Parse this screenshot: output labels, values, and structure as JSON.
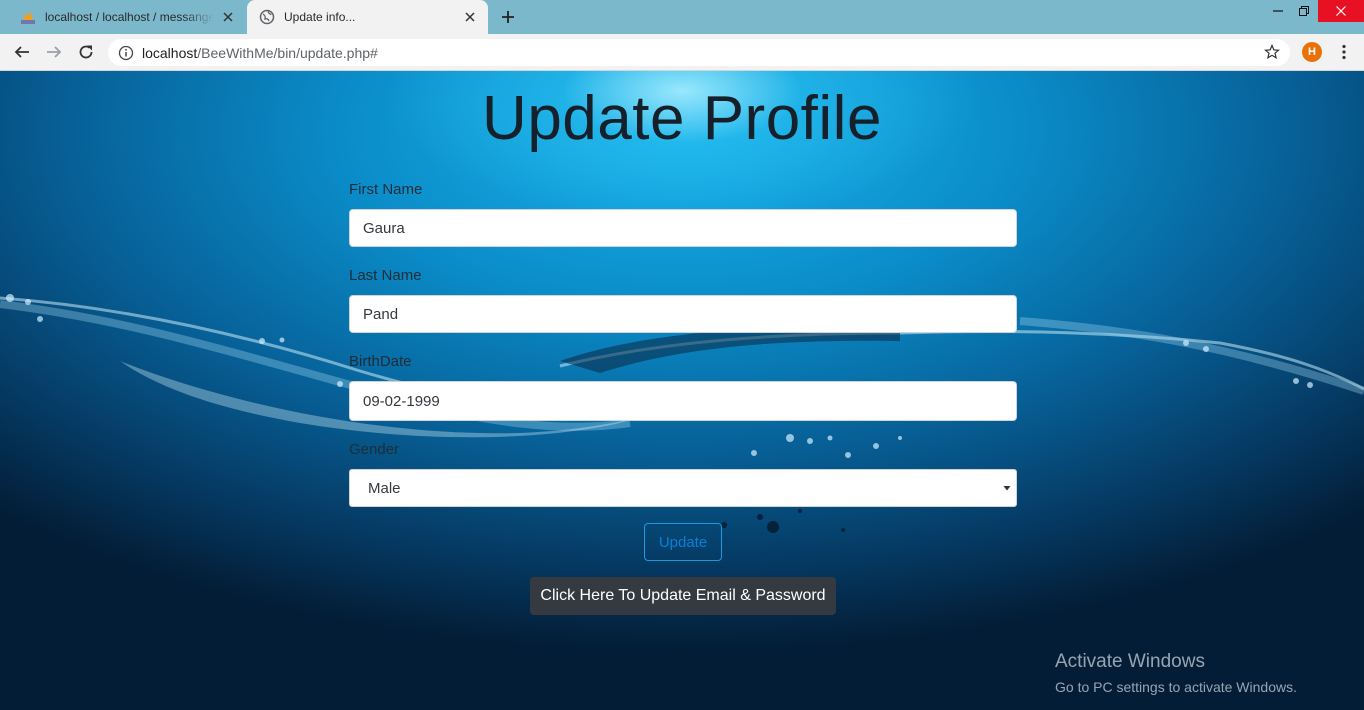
{
  "browser": {
    "tabs": [
      {
        "title": "localhost / localhost / messanger",
        "favicon": "phpmyadmin-icon",
        "active": false
      },
      {
        "title": "Update info...",
        "favicon": "globe-icon",
        "active": true
      }
    ],
    "url_host": "localhost",
    "url_path": "/BeeWithMe/bin/update.php#",
    "profile_initial": "H",
    "colors": {
      "tabbar": "#7cb8cb",
      "toolbar": "#f2f2f2",
      "avatar": "#e8710a",
      "close": "#e81123"
    }
  },
  "page": {
    "title": "Update Profile",
    "fields": {
      "first_name": {
        "label": "First Name",
        "value": "Gaura"
      },
      "last_name": {
        "label": "Last Name",
        "value": "Pand"
      },
      "birthdate": {
        "label": "BirthDate",
        "value": "09-02-1999"
      },
      "gender": {
        "label": "Gender",
        "value": "Male"
      }
    },
    "update_label": "Update",
    "email_password_label": "Click Here To Update Email & Password",
    "colors": {
      "title": "#16202a",
      "update_outline": "#1a9ad6",
      "dark_button": "#343a40"
    }
  },
  "watermark": {
    "title": "Activate Windows",
    "subtitle": "Go to PC settings to activate Windows."
  }
}
